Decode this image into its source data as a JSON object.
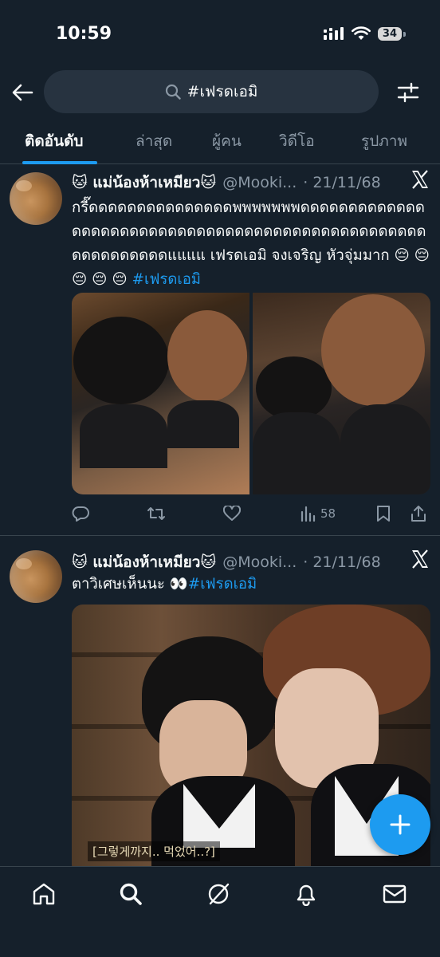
{
  "status_bar": {
    "time": "10:59",
    "battery": "34"
  },
  "search": {
    "query": "#เฟรดเอมิ"
  },
  "tabs": [
    {
      "label": "ติดอันดับ",
      "active": true
    },
    {
      "label": "ล่าสุด",
      "active": false
    },
    {
      "label": "ผู้คน",
      "active": false
    },
    {
      "label": "วิดีโอ",
      "active": false
    },
    {
      "label": "รูปภาพ",
      "active": false
    }
  ],
  "tweets": [
    {
      "name": "🐱 แม่น้องห้าเหมียว🐱",
      "handle": "@Mooki...",
      "date": "· 21/11/68",
      "text": "กรี๊ดดดดดดดดดดดดดดดพพพพพพพดดดดดดดดดดดดดดดดดดดดดดดดดดดดดดดดดดดดดดดดดดดดดดดดดดดดดดดดดดดดแแแแ เฟรดเอมิ จงเจริญ หัวจุ่มมาก 😔 😔 😔 😔 😔 ",
      "hashtag": "#เฟรดเอมิ",
      "views": "58"
    },
    {
      "name": "🐱 แม่น้องห้าเหมียว🐱",
      "handle": "@Mooki...",
      "date": "· 21/11/68",
      "text": "ตาวิเศษเห็นนะ 👀",
      "hashtag": "#เฟรดเอมิ",
      "video_caption": "[그렇게까지.. 먹었어..?]"
    }
  ],
  "colors": {
    "accent": "#1d9bf0",
    "background": "#15202b",
    "muted": "#8b98a5"
  }
}
